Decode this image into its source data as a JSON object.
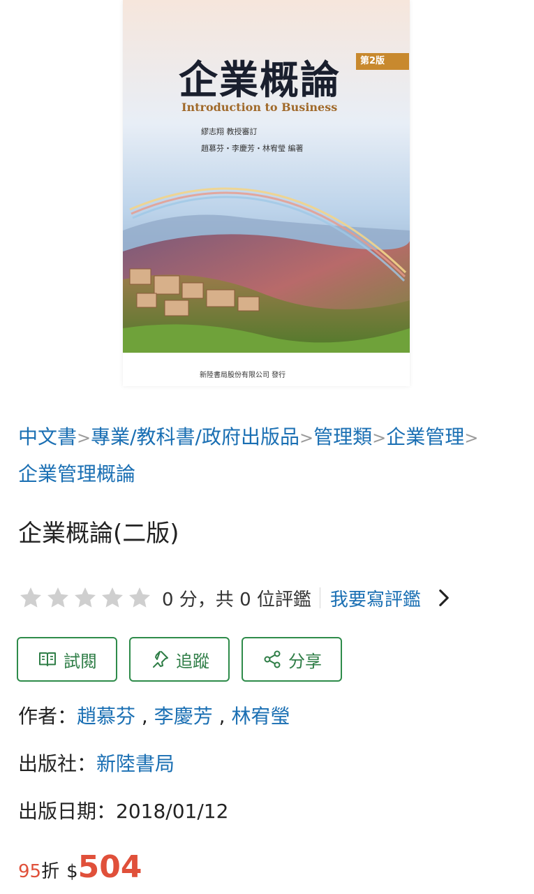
{
  "cover": {
    "title": "企業概論",
    "edition": "第2版",
    "subtitle": "Introduction to Business",
    "author_line1": "繆志翔  教授審訂",
    "author_line2": "趙慕芬・李慶芳・林宥瑩  編著",
    "publisher_line": "新陸書局股份有限公司  發行"
  },
  "breadcrumb": [
    "中文書",
    "專業/教科書/政府出版品",
    "管理類",
    "企業管理",
    "企業管理概論"
  ],
  "breadcrumb_separator": ">",
  "product": {
    "title": "企業概論(二版)"
  },
  "rating": {
    "stars_filled": 0,
    "stars_total": 5,
    "summary": "0 分，共 0 位評鑑",
    "write_review": "我要寫評鑑"
  },
  "actions": [
    {
      "label": "試閱",
      "icon": "book-open-icon"
    },
    {
      "label": "追蹤",
      "icon": "pin-icon"
    },
    {
      "label": "分享",
      "icon": "share-icon"
    }
  ],
  "info": {
    "author_label": "作者：",
    "authors": [
      "趙慕芬",
      "李慶芳",
      "林宥瑩"
    ],
    "author_sep": " , ",
    "publisher_label": "出版社：",
    "publisher": "新陸書局",
    "date_label": "出版日期：",
    "date": "2018/01/12"
  },
  "price": {
    "discount": "95",
    "discount_unit": "折",
    "currency": "$",
    "amount": "504"
  },
  "colors": {
    "link": "#1a6fb3",
    "accent_green": "#2e8b4a",
    "price_red": "#e0503a",
    "star_empty": "#cfcfcf"
  }
}
